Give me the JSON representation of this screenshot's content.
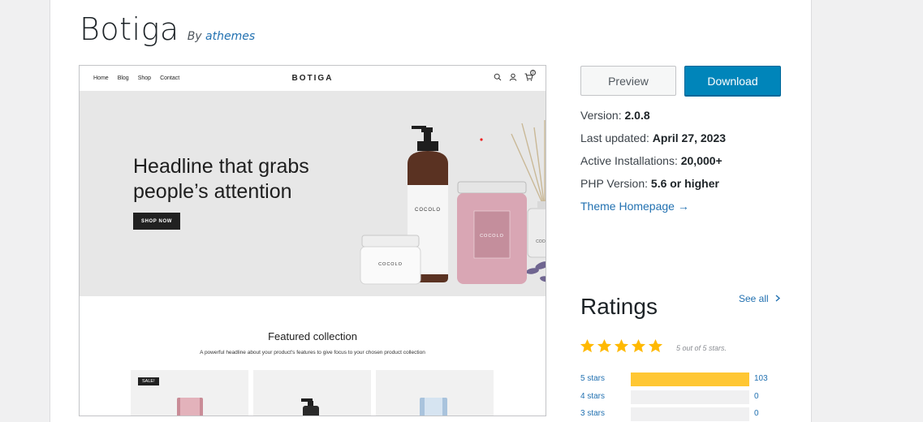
{
  "theme": {
    "name": "Botiga",
    "by_prefix": "By",
    "author": "athemes"
  },
  "screenshot": {
    "nav_links": [
      "Home",
      "Blog",
      "Shop",
      "Contact"
    ],
    "brand": "BOTIGA",
    "headline_line1": "Headline that grabs",
    "headline_line2": "people’s attention",
    "shop_button": "SHOP NOW",
    "featured_title": "Featured collection",
    "featured_subtitle": "A powerful headline about your product's features to give focus to your chosen product collection",
    "sale_badge": "SALE!",
    "cart_count": "0",
    "product_label": "COCOLO"
  },
  "actions": {
    "preview_label": "Preview",
    "download_label": "Download"
  },
  "meta": {
    "version_label": "Version:",
    "version_value": "2.0.8",
    "updated_label": "Last updated:",
    "updated_value": "April 27, 2023",
    "installs_label": "Active Installations:",
    "installs_value": "20,000+",
    "php_label": "PHP Version:",
    "php_value": "5.6 or higher",
    "homepage_link": "Theme Homepage →"
  },
  "ratings": {
    "heading": "Ratings",
    "see_all": "See all",
    "summary": "5 out of 5 stars.",
    "star_count": 5,
    "rows": [
      {
        "label": "5 stars",
        "count": "103",
        "fraction": 1.0
      },
      {
        "label": "4 stars",
        "count": "0",
        "fraction": 0
      },
      {
        "label": "3 stars",
        "count": "0",
        "fraction": 0
      }
    ]
  },
  "colors": {
    "link": "#2271b1",
    "download_bg": "#0085ba",
    "star": "#ffb900",
    "rating_fill": "#ffc733"
  }
}
